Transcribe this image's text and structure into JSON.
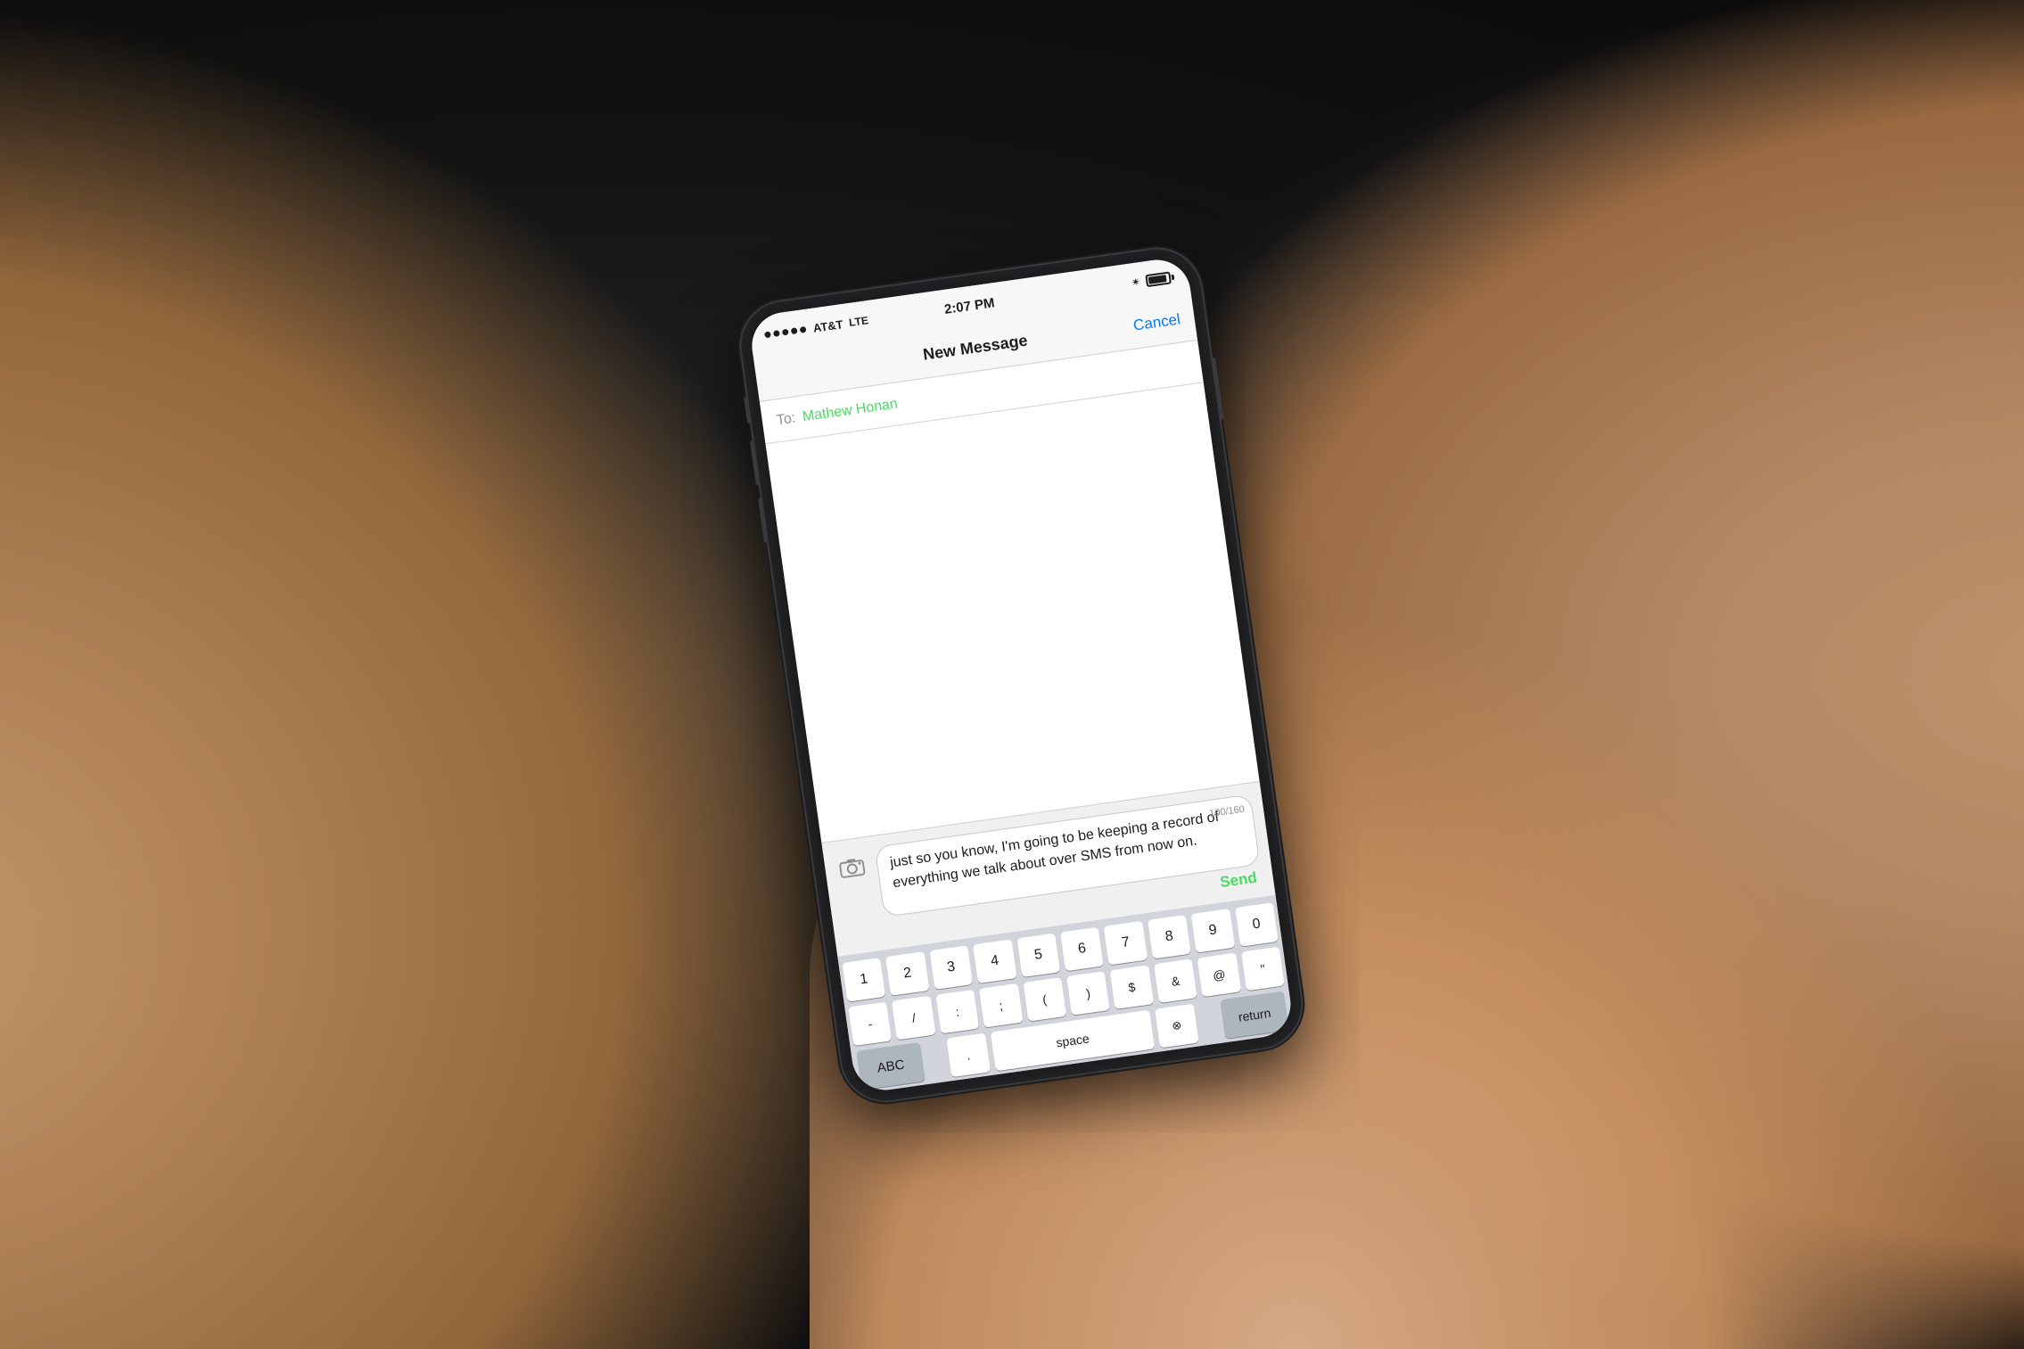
{
  "background": {
    "color": "#1a1a1a"
  },
  "status_bar": {
    "signal_dots": 5,
    "carrier": "AT&T",
    "network": "LTE",
    "time": "2:07 PM",
    "bluetooth": "✴",
    "battery_level": 90
  },
  "nav": {
    "title": "New Message",
    "cancel_label": "Cancel"
  },
  "to_field": {
    "label": "To:",
    "recipient": "Mathew Honan"
  },
  "message": {
    "text": "just so you know, I'm going to be keeping a record of everything we talk about over SMS from now on.",
    "char_count": "100/160",
    "send_label": "Send"
  },
  "camera": {
    "icon": "📷"
  },
  "keyboard": {
    "rows": [
      [
        "1",
        "2",
        "3",
        "4",
        "5",
        "6",
        "7",
        "8",
        "9",
        "0"
      ],
      [
        "-",
        "$",
        "&",
        "@",
        "\""
      ]
    ],
    "bottom": {
      "abc": "ABC",
      "space": "space",
      "delete": "⌫",
      "return": "return"
    },
    "extra_key": "⊗"
  }
}
